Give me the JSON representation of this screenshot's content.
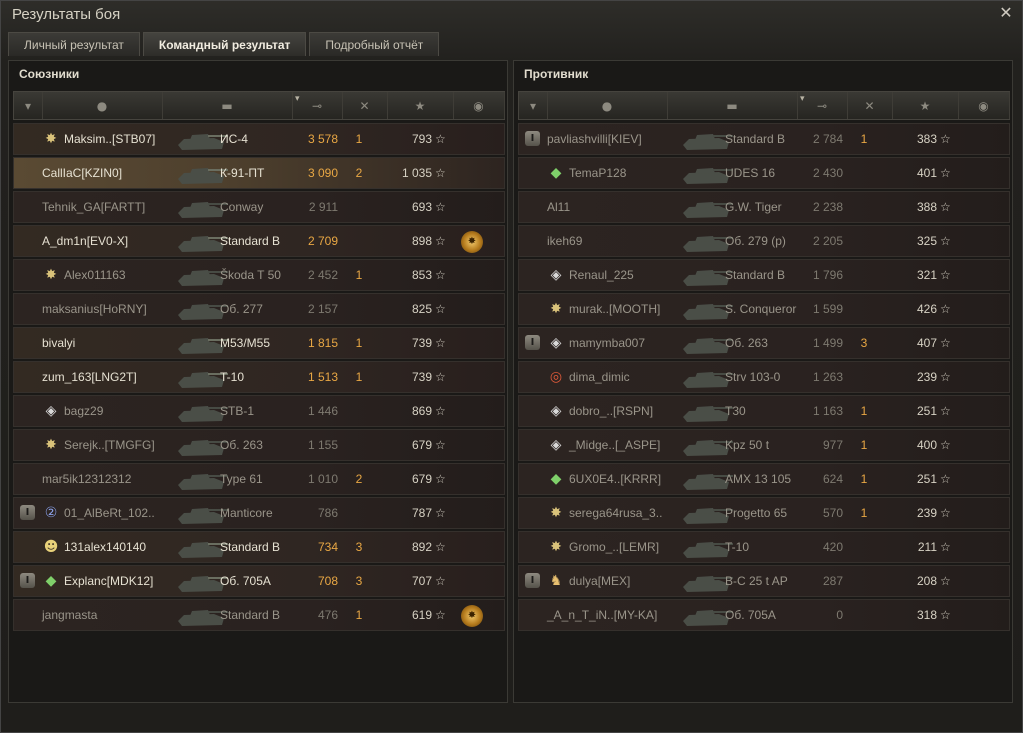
{
  "window": {
    "title": "Результаты боя",
    "close_icon": "close-icon"
  },
  "tabs": [
    "Личный результат",
    "Командный результат",
    "Подробный отчёт"
  ],
  "allies": {
    "title": "Союзники",
    "rows": [
      {
        "squad": "",
        "clan_icon": "star-badge",
        "name": "Maksim..[STB07]",
        "tank": "ИС-4",
        "damage": "3 578",
        "frags": "1",
        "xp": "793",
        "medal": "",
        "alive": true,
        "self": false
      },
      {
        "squad": "",
        "clan_icon": "",
        "name": "CallIaC[KZIN0]",
        "tank": "К-91-ПТ",
        "damage": "3 090",
        "frags": "2",
        "xp": "1 035",
        "medal": "",
        "alive": true,
        "self": true
      },
      {
        "squad": "",
        "clan_icon": "",
        "name": "Tehnik_GA[FARTT]",
        "tank": "Conway",
        "damage": "2 911",
        "frags": "",
        "xp": "693",
        "medal": "",
        "alive": false,
        "self": false
      },
      {
        "squad": "",
        "clan_icon": "",
        "name": "A_dm1n[EV0-X]",
        "tank": "Standard B",
        "damage": "2 709",
        "frags": "",
        "xp": "898",
        "medal": "medal",
        "alive": true,
        "self": false
      },
      {
        "squad": "",
        "clan_icon": "star-badge",
        "name": "Alex011163",
        "tank": "Škoda T 50",
        "damage": "2 452",
        "frags": "1",
        "xp": "853",
        "medal": "",
        "alive": false,
        "self": false
      },
      {
        "squad": "",
        "clan_icon": "",
        "name": "maksanius[HoRNY]",
        "tank": "Об. 277",
        "damage": "2 157",
        "frags": "",
        "xp": "825",
        "medal": "",
        "alive": false,
        "self": false
      },
      {
        "squad": "",
        "clan_icon": "",
        "name": "bivalyi",
        "tank": "M53/M55",
        "damage": "1 815",
        "frags": "1",
        "xp": "739",
        "medal": "",
        "alive": true,
        "self": false
      },
      {
        "squad": "",
        "clan_icon": "",
        "name": "zum_163[LNG2T]",
        "tank": "T-10",
        "damage": "1 513",
        "frags": "1",
        "xp": "739",
        "medal": "",
        "alive": true,
        "self": false
      },
      {
        "squad": "",
        "clan_icon": "diamond-badge",
        "name": "bagz29",
        "tank": "STB-1",
        "damage": "1 446",
        "frags": "",
        "xp": "869",
        "medal": "",
        "alive": false,
        "self": false
      },
      {
        "squad": "",
        "clan_icon": "star-badge",
        "name": "Serejk..[TMGFG]",
        "tank": "Об. 263",
        "damage": "1 155",
        "frags": "",
        "xp": "679",
        "medal": "",
        "alive": false,
        "self": false
      },
      {
        "squad": "",
        "clan_icon": "",
        "name": "mar5ik12312312",
        "tank": "Type 61",
        "damage": "1 010",
        "frags": "2",
        "xp": "679",
        "medal": "",
        "alive": false,
        "self": false
      },
      {
        "squad": "I",
        "clan_icon": "number-2-badge",
        "name": "01_AlBeRt_102..",
        "tank": "Manticore",
        "damage": "786",
        "frags": "",
        "xp": "787",
        "medal": "",
        "alive": false,
        "self": false
      },
      {
        "squad": "",
        "clan_icon": "skull-badge",
        "name": "131alex140140",
        "tank": "Standard B",
        "damage": "734",
        "frags": "3",
        "xp": "892",
        "medal": "",
        "alive": true,
        "self": false
      },
      {
        "squad": "I",
        "clan_icon": "cube-badge",
        "name": "Explanc[MDK12]",
        "tank": "Об. 705А",
        "damage": "708",
        "frags": "3",
        "xp": "707",
        "medal": "",
        "alive": true,
        "self": false
      },
      {
        "squad": "",
        "clan_icon": "",
        "name": "jangmasta",
        "tank": "Standard B",
        "damage": "476",
        "frags": "1",
        "xp": "619",
        "medal": "medal",
        "alive": false,
        "self": false
      }
    ]
  },
  "enemies": {
    "title": "Противник",
    "rows": [
      {
        "squad": "I",
        "clan_icon": "",
        "name": "pavliashvilli[KIEV]",
        "tank": "Standard B",
        "damage": "2 784",
        "frags": "1",
        "xp": "383",
        "medal": "",
        "alive": false,
        "self": false
      },
      {
        "squad": "",
        "clan_icon": "cube-badge",
        "name": "TemaP128",
        "tank": "UDES 16",
        "damage": "2 430",
        "frags": "",
        "xp": "401",
        "medal": "",
        "alive": false,
        "self": false
      },
      {
        "squad": "",
        "clan_icon": "",
        "name": "Al11",
        "tank": "G.W. Tiger",
        "damage": "2 238",
        "frags": "",
        "xp": "388",
        "medal": "",
        "alive": false,
        "self": false
      },
      {
        "squad": "",
        "clan_icon": "",
        "name": "ikeh69",
        "tank": "Об. 279 (р)",
        "damage": "2 205",
        "frags": "",
        "xp": "325",
        "medal": "",
        "alive": false,
        "self": false
      },
      {
        "squad": "",
        "clan_icon": "diamond-badge",
        "name": "Renaul_225",
        "tank": "Standard B",
        "damage": "1 796",
        "frags": "",
        "xp": "321",
        "medal": "",
        "alive": false,
        "self": false
      },
      {
        "squad": "",
        "clan_icon": "star-badge",
        "name": "murak..[MOOTH]",
        "tank": "S. Conqueror",
        "damage": "1 599",
        "frags": "",
        "xp": "426",
        "medal": "",
        "alive": false,
        "self": false
      },
      {
        "squad": "I",
        "clan_icon": "diamond-badge",
        "name": "mamymba007",
        "tank": "Об. 263",
        "damage": "1 499",
        "frags": "3",
        "xp": "407",
        "medal": "",
        "alive": false,
        "self": false
      },
      {
        "squad": "",
        "clan_icon": "target-badge",
        "name": "dima_dimic",
        "tank": "Strv 103-0",
        "damage": "1 263",
        "frags": "",
        "xp": "239",
        "medal": "",
        "alive": false,
        "self": false
      },
      {
        "squad": "",
        "clan_icon": "diamond-badge",
        "name": "dobro_..[RSPN]",
        "tank": "T30",
        "damage": "1 163",
        "frags": "1",
        "xp": "251",
        "medal": "",
        "alive": false,
        "self": false
      },
      {
        "squad": "",
        "clan_icon": "diamond-badge",
        "name": "_Midge..[_ASPE]",
        "tank": "Kpz 50 t",
        "damage": "977",
        "frags": "1",
        "xp": "400",
        "medal": "",
        "alive": false,
        "self": false
      },
      {
        "squad": "",
        "clan_icon": "cube-badge",
        "name": "6UX0E4..[KRRR]",
        "tank": "AMX 13 105",
        "damage": "624",
        "frags": "1",
        "xp": "251",
        "medal": "",
        "alive": false,
        "self": false
      },
      {
        "squad": "",
        "clan_icon": "star-badge",
        "name": "serega64rusa_3..",
        "tank": "Progetto 65",
        "damage": "570",
        "frags": "1",
        "xp": "239",
        "medal": "",
        "alive": false,
        "self": false
      },
      {
        "squad": "",
        "clan_icon": "star-badge",
        "name": "Gromo_..[LEMR]",
        "tank": "T-10",
        "damage": "420",
        "frags": "",
        "xp": "211",
        "medal": "",
        "alive": false,
        "self": false
      },
      {
        "squad": "I",
        "clan_icon": "bear-badge",
        "name": "dulya[MEX]",
        "tank": "B-C 25 t AP",
        "damage": "287",
        "frags": "",
        "xp": "208",
        "medal": "",
        "alive": false,
        "self": false
      },
      {
        "squad": "",
        "clan_icon": "",
        "name": "_A_n_T_iN..[MY-KA]",
        "tank": "Об. 705А",
        "damage": "0",
        "frags": "",
        "xp": "318",
        "medal": "",
        "alive": false,
        "self": false
      }
    ]
  },
  "headers": [
    "squad-icon",
    "player-icon",
    "tank-icon",
    "damage-icon",
    "frags-icon",
    "xp-star-icon",
    "medal-icon"
  ],
  "glyphs": {
    "xp_star": "☆"
  }
}
